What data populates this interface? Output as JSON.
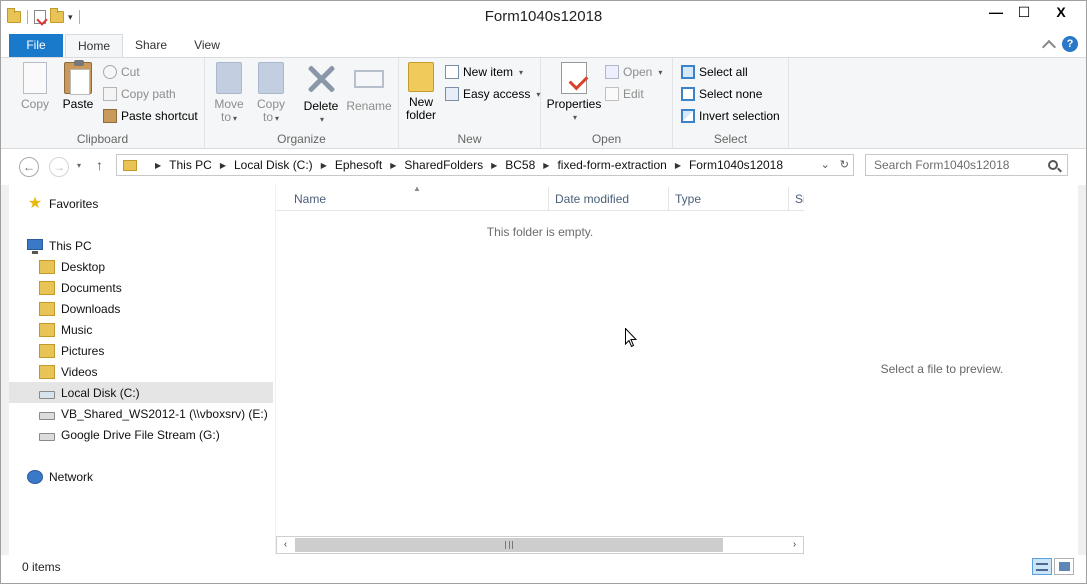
{
  "window": {
    "title": "Form1040s12018"
  },
  "window_controls": {
    "minimize": "—",
    "maximize": "☐",
    "close": "X"
  },
  "qat": {
    "dropdown": "▾"
  },
  "ribbon_tabs": {
    "file": "File",
    "home": "Home",
    "share": "Share",
    "view": "View"
  },
  "help": {
    "label": "?"
  },
  "clipboard": {
    "label": "Clipboard",
    "copy": "Copy",
    "paste": "Paste",
    "cut": "Cut",
    "copy_path": "Copy path",
    "paste_shortcut": "Paste shortcut"
  },
  "organize": {
    "label": "Organize",
    "move_to_line1": "Move",
    "move_to_line2": "to",
    "copy_to_line1": "Copy",
    "copy_to_line2": "to",
    "delete": "Delete",
    "rename": "Rename"
  },
  "new_group": {
    "label": "New",
    "new_folder_line1": "New",
    "new_folder_line2": "folder",
    "new_item": "New item",
    "easy_access": "Easy access"
  },
  "open_group": {
    "label": "Open",
    "properties": "Properties",
    "open": "Open",
    "edit": "Edit"
  },
  "select_group": {
    "label": "Select",
    "select_all": "Select all",
    "select_none": "Select none",
    "invert_selection": "Invert selection"
  },
  "address": {
    "crumbs": [
      "This PC",
      "Local Disk (C:)",
      "Ephesoft",
      "SharedFolders",
      "BC58",
      "fixed-form-extraction",
      "Form1040s12018"
    ]
  },
  "search": {
    "placeholder": "Search Form1040s12018"
  },
  "nav_pane": {
    "favorites": "Favorites",
    "this_pc": "This PC",
    "items": [
      "Desktop",
      "Documents",
      "Downloads",
      "Music",
      "Pictures",
      "Videos"
    ],
    "local_disk": "Local Disk (C:)",
    "vb_shared": "VB_Shared_WS2012-1 (\\\\vboxsrv) (E:)",
    "google_drive": "Google Drive File Stream (G:)",
    "network": "Network"
  },
  "columns": {
    "name": "Name",
    "date_modified": "Date modified",
    "type": "Type",
    "size": "Si"
  },
  "file_list": {
    "empty_message": "This folder is empty."
  },
  "preview": {
    "message": "Select a file to preview."
  },
  "status": {
    "items": "0 items"
  }
}
